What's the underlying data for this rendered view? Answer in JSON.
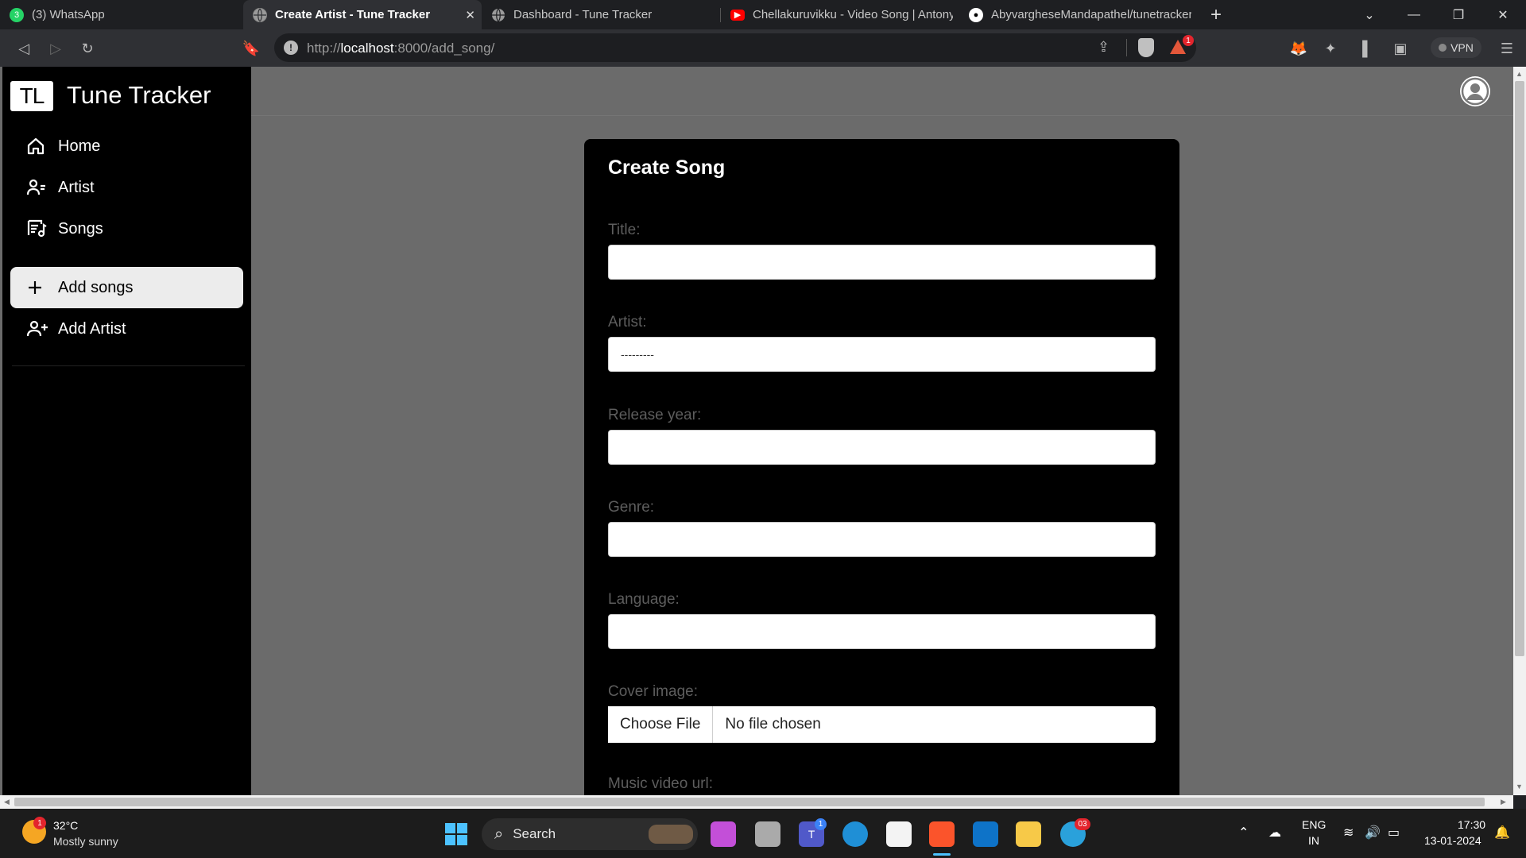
{
  "browser": {
    "tabs": [
      {
        "title": "(3) WhatsApp",
        "favicon": "whatsapp-icon",
        "badge": "3"
      },
      {
        "title": "Create Artist - Tune Tracker",
        "favicon": "globe-icon",
        "active": true
      },
      {
        "title": "Dashboard - Tune Tracker",
        "favicon": "globe-icon"
      },
      {
        "title": "Chellakuruvikku - Video Song | Antony",
        "favicon": "youtube-icon"
      },
      {
        "title": "AbyvargheseMandapathel/tunetracker",
        "favicon": "github-icon"
      }
    ],
    "new_tab": "+",
    "url_prefix": "http://",
    "url_host": "localhost",
    "url_rest": ":8000/add_song/",
    "vpn_label": "VPN",
    "brave_alert_count": "1"
  },
  "app": {
    "logo": "TL",
    "brand": "Tune Tracker",
    "nav": [
      {
        "label": "Home",
        "icon": "home-icon"
      },
      {
        "label": "Artist",
        "icon": "artist-icon"
      },
      {
        "label": "Songs",
        "icon": "songs-icon"
      },
      {
        "label": "Add songs",
        "icon": "plus-icon",
        "active": true
      },
      {
        "label": "Add Artist",
        "icon": "add-user-icon"
      }
    ]
  },
  "form": {
    "heading": "Create Song",
    "fields": [
      {
        "label": "Title:",
        "value": ""
      },
      {
        "label": "Artist:",
        "value": "---------"
      },
      {
        "label": "Release year:",
        "value": ""
      },
      {
        "label": "Genre:",
        "value": ""
      },
      {
        "label": "Language:",
        "value": ""
      },
      {
        "label": "Cover image:",
        "button": "Choose File",
        "status": "No file chosen"
      },
      {
        "label": "Music video url:"
      }
    ]
  },
  "taskbar": {
    "weather_temp": "32°C",
    "weather_desc": "Mostly sunny",
    "weather_badge": "1",
    "search_label": "Search",
    "lang_1": "ENG",
    "lang_2": "IN",
    "time": "17:30",
    "date": "13-01-2024",
    "teams_badge": "1",
    "telegram_badge": "03"
  },
  "colors": {
    "page_bg": "#6b6b6b",
    "sidebar_bg": "#000000",
    "card_bg": "#000000",
    "active_nav": "#ececec",
    "label_text": "#5d5d5d"
  }
}
